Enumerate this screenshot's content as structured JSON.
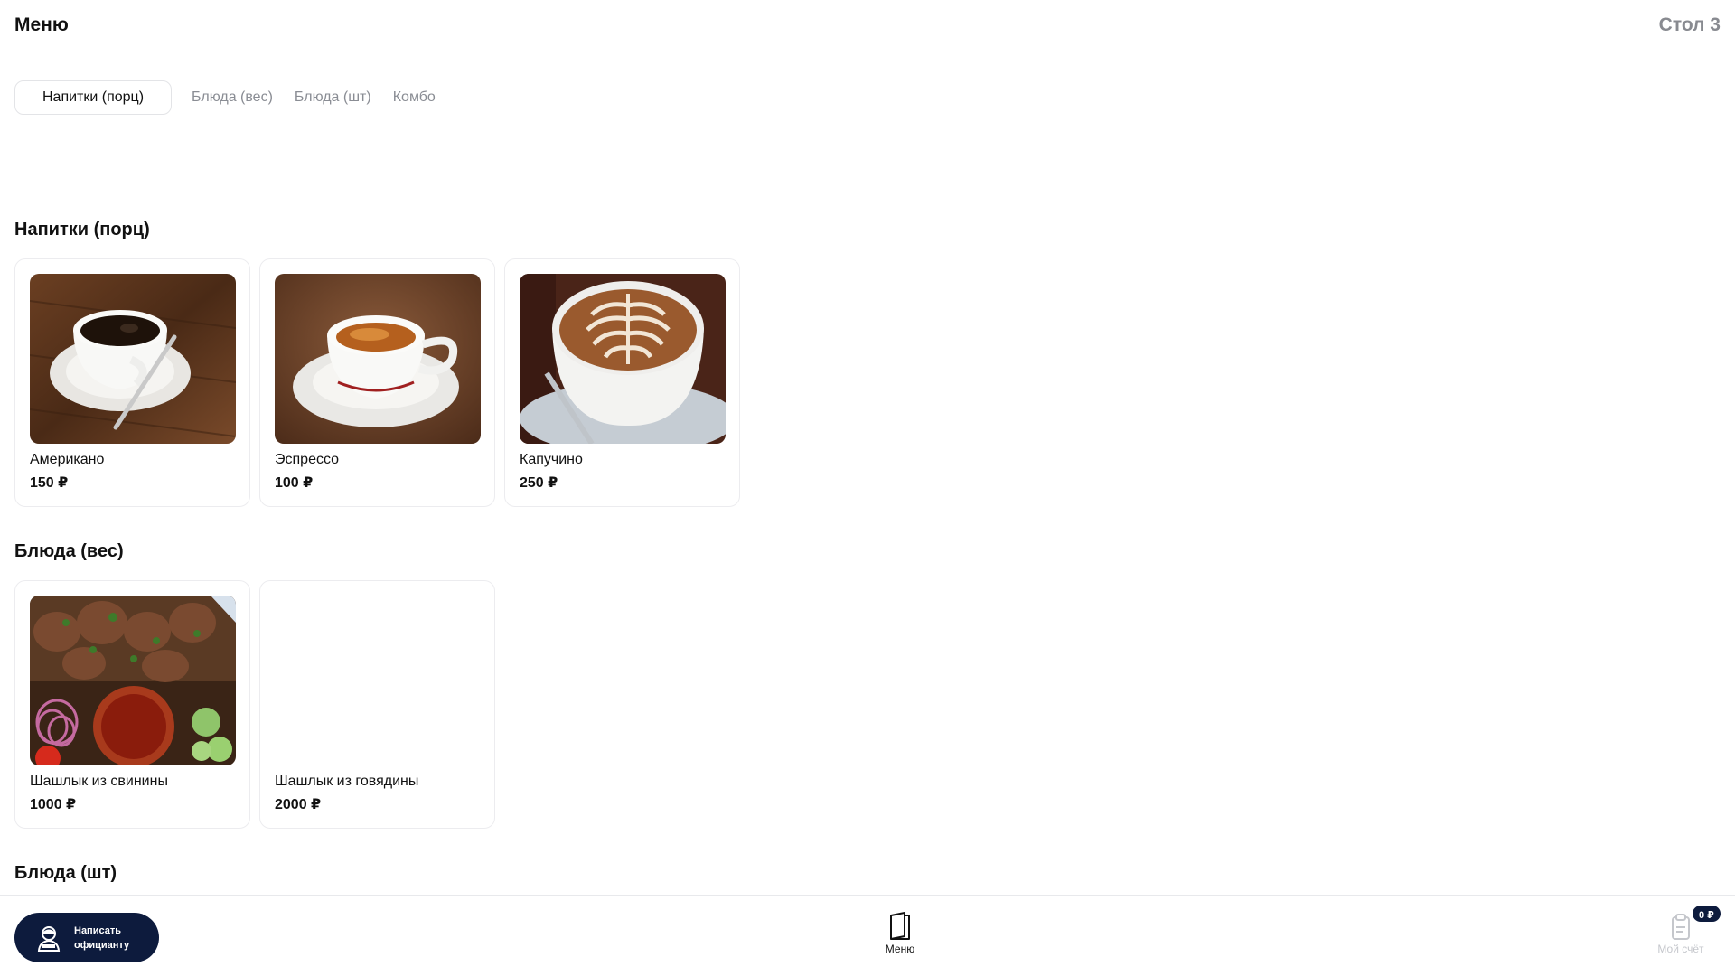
{
  "header": {
    "title": "Меню",
    "table": "Стол 3"
  },
  "tabs": [
    {
      "label": "Напитки (порц)",
      "active": true
    },
    {
      "label": "Блюда (вес)",
      "active": false
    },
    {
      "label": "Блюда (шт)",
      "active": false
    },
    {
      "label": "Комбо",
      "active": false
    }
  ],
  "sections": [
    {
      "title": "Напитки (порц)",
      "items": [
        {
          "name": "Американо",
          "price": "150 ₽",
          "image": "americano-photo"
        },
        {
          "name": "Эспрессо",
          "price": "100 ₽",
          "image": "espresso-photo"
        },
        {
          "name": "Капучино",
          "price": "250 ₽",
          "image": "cappuccino-photo"
        }
      ]
    },
    {
      "title": "Блюда (вес)",
      "items": [
        {
          "name": "Шашлык из свинины",
          "price": "1000 ₽",
          "image": "pork-shashlik-photo"
        },
        {
          "name": "Шашлык из говядины",
          "price": "2000 ₽",
          "image": ""
        }
      ]
    },
    {
      "title": "Блюда (шт)",
      "items": []
    }
  ],
  "bottom_bar": {
    "waiter_button": "Написать\nофицианту",
    "menu_label": "Меню",
    "bill_label": "Мой счёт",
    "bill_badge": "0 ₽"
  },
  "colors": {
    "accent": "#0d1b3d",
    "muted": "#8a8d94",
    "border": "#ececef"
  }
}
